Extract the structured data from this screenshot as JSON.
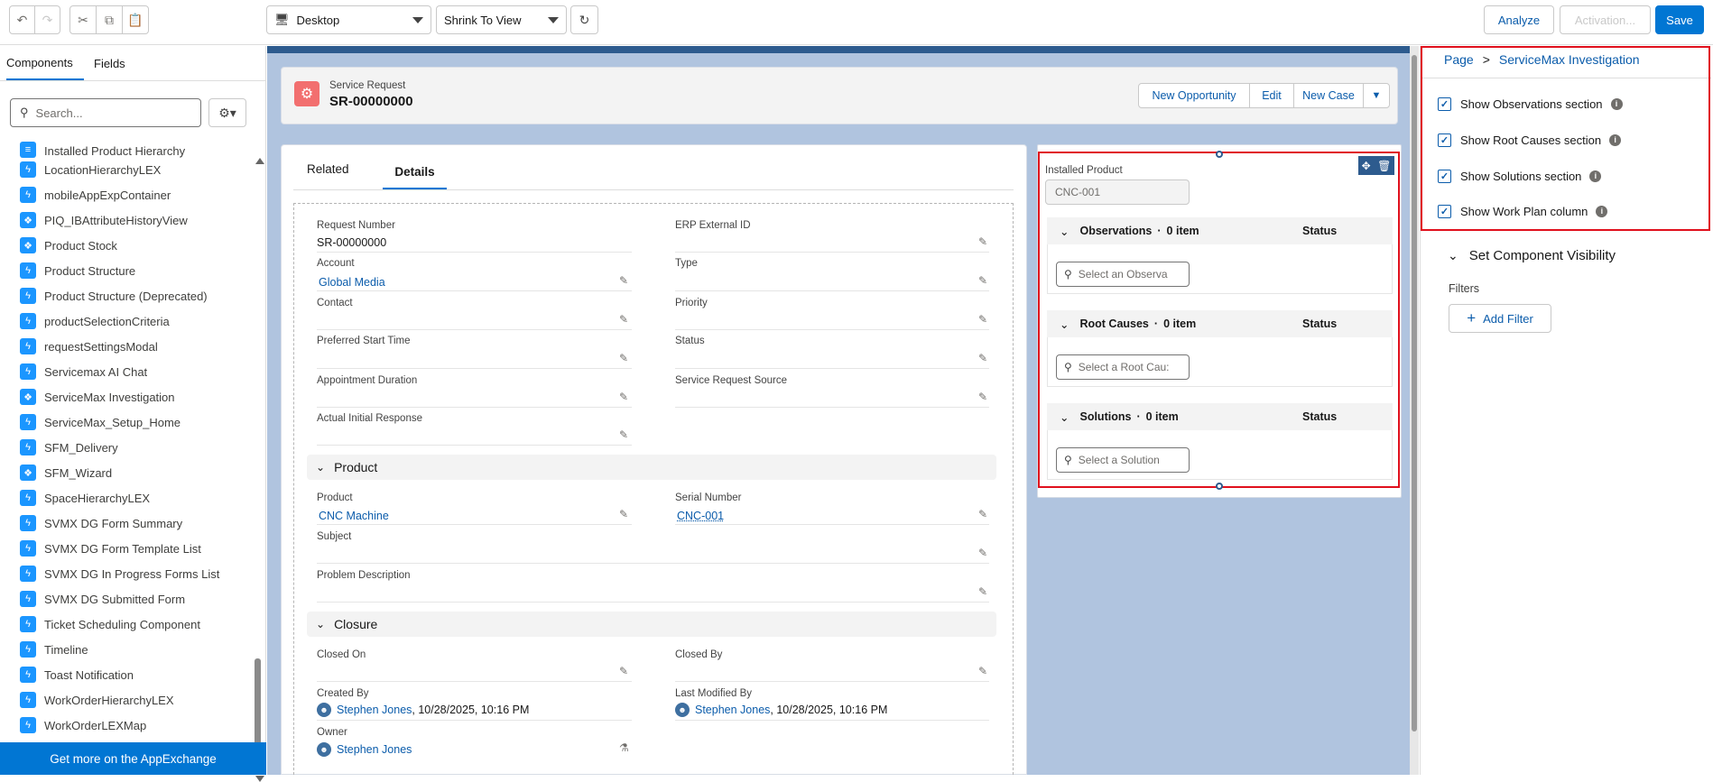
{
  "toolbar": {
    "device_select": "Desktop",
    "view_select": "Shrink To View",
    "analyze": "Analyze",
    "activation": "Activation...",
    "save": "Save"
  },
  "left_panel": {
    "tabs": [
      "Components",
      "Fields"
    ],
    "search_placeholder": "Search...",
    "partial_top_item": "Installed Product Hierarchy",
    "items": [
      {
        "label": "LocationHierarchyLEX",
        "icon": "bolt"
      },
      {
        "label": "mobileAppExpContainer",
        "icon": "bolt"
      },
      {
        "label": "PIQ_IBAttributeHistoryView",
        "icon": "cube"
      },
      {
        "label": "Product Stock",
        "icon": "cube"
      },
      {
        "label": "Product Structure",
        "icon": "bolt"
      },
      {
        "label": "Product Structure (Deprecated)",
        "icon": "bolt"
      },
      {
        "label": "productSelectionCriteria",
        "icon": "bolt"
      },
      {
        "label": "requestSettingsModal",
        "icon": "bolt"
      },
      {
        "label": "Servicemax AI Chat",
        "icon": "bolt"
      },
      {
        "label": "ServiceMax Investigation",
        "icon": "cube"
      },
      {
        "label": "ServiceMax_Setup_Home",
        "icon": "bolt"
      },
      {
        "label": "SFM_Delivery",
        "icon": "bolt"
      },
      {
        "label": "SFM_Wizard",
        "icon": "cube"
      },
      {
        "label": "SpaceHierarchyLEX",
        "icon": "bolt"
      },
      {
        "label": "SVMX DG Form Summary",
        "icon": "bolt"
      },
      {
        "label": "SVMX DG Form Template List",
        "icon": "bolt"
      },
      {
        "label": "SVMX DG In Progress Forms List",
        "icon": "bolt"
      },
      {
        "label": "SVMX DG Submitted Form",
        "icon": "bolt"
      },
      {
        "label": "Ticket Scheduling Component",
        "icon": "bolt"
      },
      {
        "label": "Timeline",
        "icon": "bolt"
      },
      {
        "label": "Toast Notification",
        "icon": "bolt"
      },
      {
        "label": "WorkOrderHierarchyLEX",
        "icon": "bolt"
      },
      {
        "label": "WorkOrderLEXMap",
        "icon": "bolt"
      }
    ],
    "appexchange": "Get more on the AppExchange"
  },
  "header": {
    "object": "Service Request",
    "record": "SR-00000000",
    "actions": [
      "New Opportunity",
      "Edit",
      "New Case"
    ]
  },
  "detail_tabs": [
    "Related",
    "Details"
  ],
  "fields": {
    "request_number_label": "Request Number",
    "request_number": "SR-00000000",
    "erp_label": "ERP External ID",
    "account_label": "Account",
    "account": "Global Media",
    "type_label": "Type",
    "contact_label": "Contact",
    "priority_label": "Priority",
    "pst_label": "Preferred Start Time",
    "status_label": "Status",
    "appt_label": "Appointment Duration",
    "srs_label": "Service Request Source",
    "air_label": "Actual Initial Response",
    "product_section": "Product",
    "product_label": "Product",
    "product": "CNC Machine",
    "serial_label": "Serial Number",
    "serial": "CNC-001",
    "subject_label": "Subject",
    "problem_label": "Problem Description",
    "closure_section": "Closure",
    "closed_on_label": "Closed On",
    "closed_by_label": "Closed By",
    "created_by_label": "Created By",
    "created_by": "Stephen Jones",
    "created_date": ", 10/28/2025, 10:16 PM",
    "modified_label": "Last Modified By",
    "modified_by": "Stephen Jones",
    "modified_date": ", 10/28/2025, 10:16 PM",
    "owner_label": "Owner",
    "owner": "Stephen Jones"
  },
  "investigation": {
    "ip_label": "Installed Product",
    "ip_value": "CNC-001",
    "observations": {
      "title": "Observations",
      "count": "0 item",
      "status": "Status",
      "placeholder": "Select an Observa"
    },
    "root_causes": {
      "title": "Root Causes",
      "count": "0 item",
      "status": "Status",
      "placeholder": "Select a Root Cau:"
    },
    "solutions": {
      "title": "Solutions",
      "count": "0 item",
      "status": "Status",
      "placeholder": "Select a Solution"
    }
  },
  "properties": {
    "breadcrumb_page": "Page",
    "breadcrumb_sep": ">",
    "breadcrumb_current": "ServiceMax Investigation",
    "options": [
      {
        "label": "Show Observations section",
        "checked": true
      },
      {
        "label": "Show Root Causes section",
        "checked": true
      },
      {
        "label": "Show Solutions section",
        "checked": true
      },
      {
        "label": "Show Work Plan column",
        "checked": true
      }
    ],
    "visibility": "Set Component Visibility",
    "filters": "Filters",
    "add_filter": "Add Filter"
  },
  "colors": {
    "accent": "#0176d3",
    "highlight": "#e0101d",
    "canvas": "#b0c4df"
  }
}
